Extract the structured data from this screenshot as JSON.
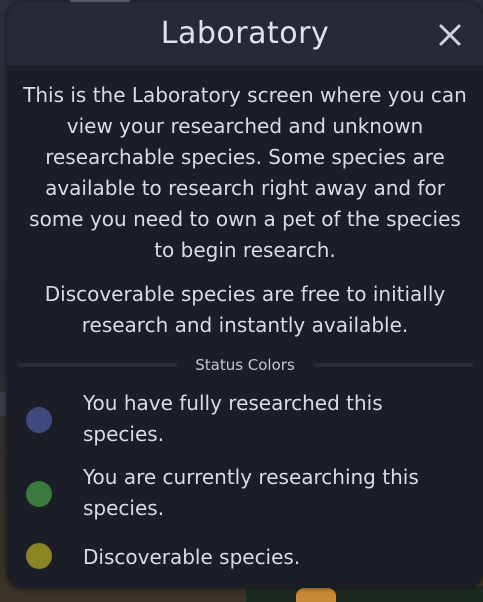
{
  "dialog": {
    "title": "Laboratory",
    "close_icon": "close-icon",
    "description": "This is the Laboratory screen where you can view your researched and unknown researchable species. Some species are available to research right away and for some you need to own a pet of the species to begin research.",
    "description_2": "Discoverable species are free to initially research and instantly available.",
    "status_section_label": "Status Colors",
    "statuses": [
      {
        "label": "You have fully researched this species.",
        "color": "#3e4a7e"
      },
      {
        "label": "You are currently researching this species.",
        "color": "#3a7a3e"
      },
      {
        "label": "Discoverable species.",
        "color": "#8a8424"
      }
    ]
  },
  "colors": {
    "dialog_bg": "#1b1e27",
    "header_bg": "#262a36",
    "text": "#d9dce3"
  }
}
